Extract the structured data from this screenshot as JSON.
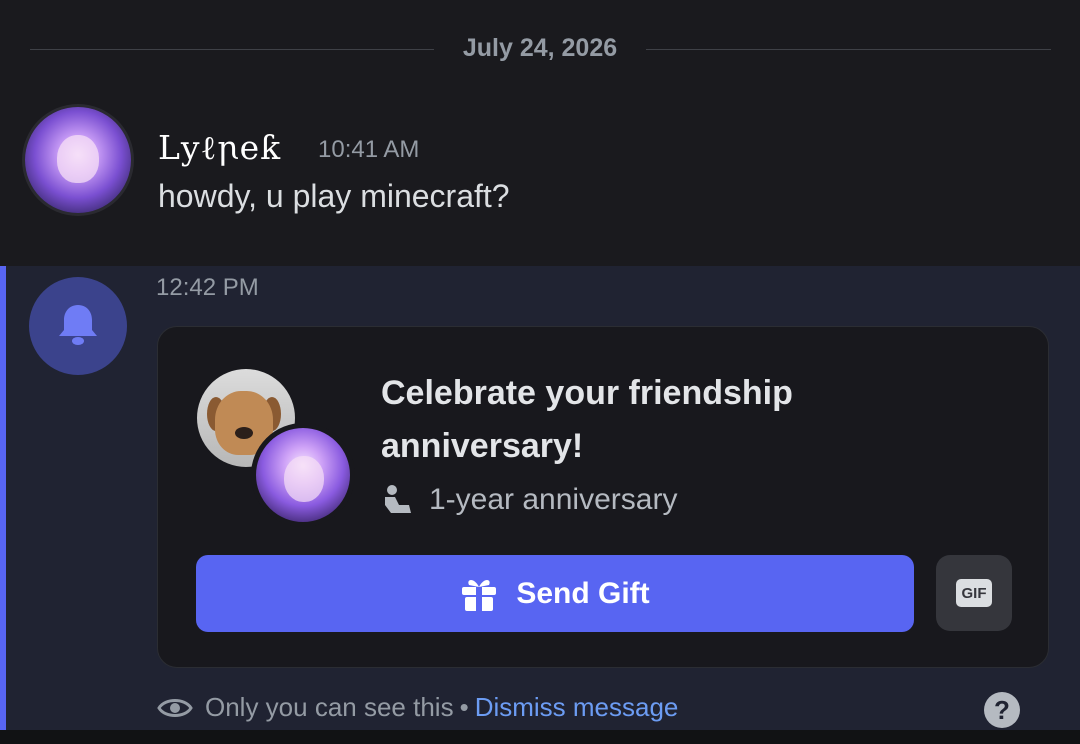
{
  "date_divider": "July 24, 2026",
  "message": {
    "username": "Ⅼyℓꞃeƙ",
    "time": "10:41 AM",
    "text": "howdy, u play minecraft?"
  },
  "system_message": {
    "time": "12:42 PM",
    "card": {
      "title": "Celebrate your friendship anniversary!",
      "subtitle": "1-year anniversary",
      "send_label": "Send Gift",
      "gif_label": "GIF"
    },
    "footer": {
      "visibility_text": "Only you can see this",
      "separator": "•",
      "dismiss_label": "Dismiss message",
      "help_label": "?"
    }
  },
  "colors": {
    "accent": "#5865f2",
    "system_bg": "#202332",
    "link": "#6c9cf3"
  },
  "icons": [
    "bell-icon",
    "handshake-icon",
    "gift-icon",
    "gif-icon",
    "eye-icon",
    "help-icon"
  ]
}
